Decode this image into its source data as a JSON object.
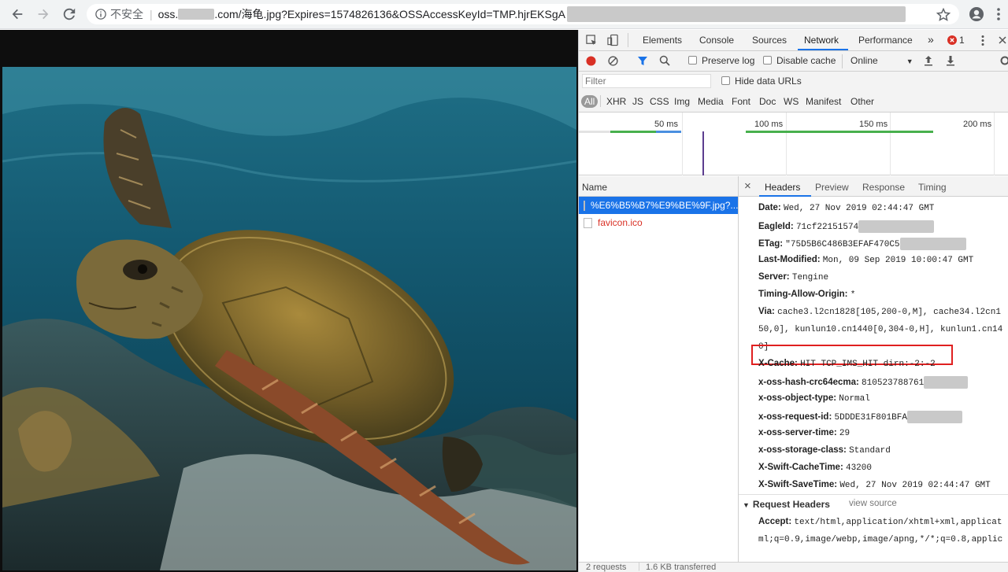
{
  "browser": {
    "insecure_label": "不安全",
    "url_host_prefix": "oss.",
    "url_rest": ".com/海龟.jpg?Expires=1574826136&OSSAccessKeyId=TMP.hjrEKSgA"
  },
  "devtools": {
    "tabs": [
      "Elements",
      "Console",
      "Sources",
      "Network",
      "Performance"
    ],
    "more_tabs": "»",
    "error_count": "1",
    "toolbar": {
      "preserve_log": "Preserve log",
      "disable_cache": "Disable cache",
      "throttle": "Online"
    },
    "filter_placeholder": "Filter",
    "hide_data_urls": "Hide data URLs",
    "types": [
      "All",
      "XHR",
      "JS",
      "CSS",
      "Img",
      "Media",
      "Font",
      "Doc",
      "WS",
      "Manifest",
      "Other"
    ],
    "timeline_ticks": [
      "50 ms",
      "100 ms",
      "150 ms",
      "200 ms"
    ],
    "list_header": "Name",
    "requests": [
      {
        "name": "%E6%B5%B7%E9%BE%9F.jpg?..."
      },
      {
        "name": "favicon.ico"
      }
    ],
    "detail_tabs": [
      "Headers",
      "Preview",
      "Response",
      "Timing"
    ],
    "close_glyph": "×",
    "response_headers": [
      {
        "key": "Date:",
        "value": "Wed, 27 Nov 2019 02:44:47 GMT"
      },
      {
        "key": "EagleId:",
        "value": "71cf22151574"
      },
      {
        "key": "ETag:",
        "value": "\"75D5B6C486B3EFAF470C5"
      },
      {
        "key": "Last-Modified:",
        "value": "Mon, 09 Sep 2019 10:00:47 GMT"
      },
      {
        "key": "Server:",
        "value": "Tengine"
      },
      {
        "key": "Timing-Allow-Origin:",
        "value": "*"
      },
      {
        "key": "Via:",
        "value": "cache3.l2cn1828[105,200-0,M], cache34.l2cn1"
      },
      {
        "key": "",
        "value": "50,0], kunlun10.cn1440[0,304-0,H], kunlun1.cn14"
      },
      {
        "key": "",
        "value": "0]"
      },
      {
        "key": "X-Cache:",
        "value": "HIT TCP_IMS_HIT dirn:-2:-2"
      },
      {
        "key": "x-oss-hash-crc64ecma:",
        "value": "810523788761"
      },
      {
        "key": "x-oss-object-type:",
        "value": "Normal"
      },
      {
        "key": "x-oss-request-id:",
        "value": "5DDDE31F801BFA"
      },
      {
        "key": "x-oss-server-time:",
        "value": "29"
      },
      {
        "key": "x-oss-storage-class:",
        "value": "Standard"
      },
      {
        "key": "X-Swift-CacheTime:",
        "value": "43200"
      },
      {
        "key": "X-Swift-SaveTime:",
        "value": "Wed, 27 Nov 2019 02:44:47 GMT"
      }
    ],
    "request_headers_title": "Request Headers",
    "view_source": "view source",
    "request_headers": [
      {
        "key": "Accept:",
        "value": "text/html,application/xhtml+xml,applicat"
      },
      {
        "key": "",
        "value": "ml;q=0.9,image/webp,image/apng,*/*;q=0.8,applic"
      }
    ],
    "status": {
      "requests": "2 requests",
      "transferred": "1.6 KB transferred"
    }
  }
}
